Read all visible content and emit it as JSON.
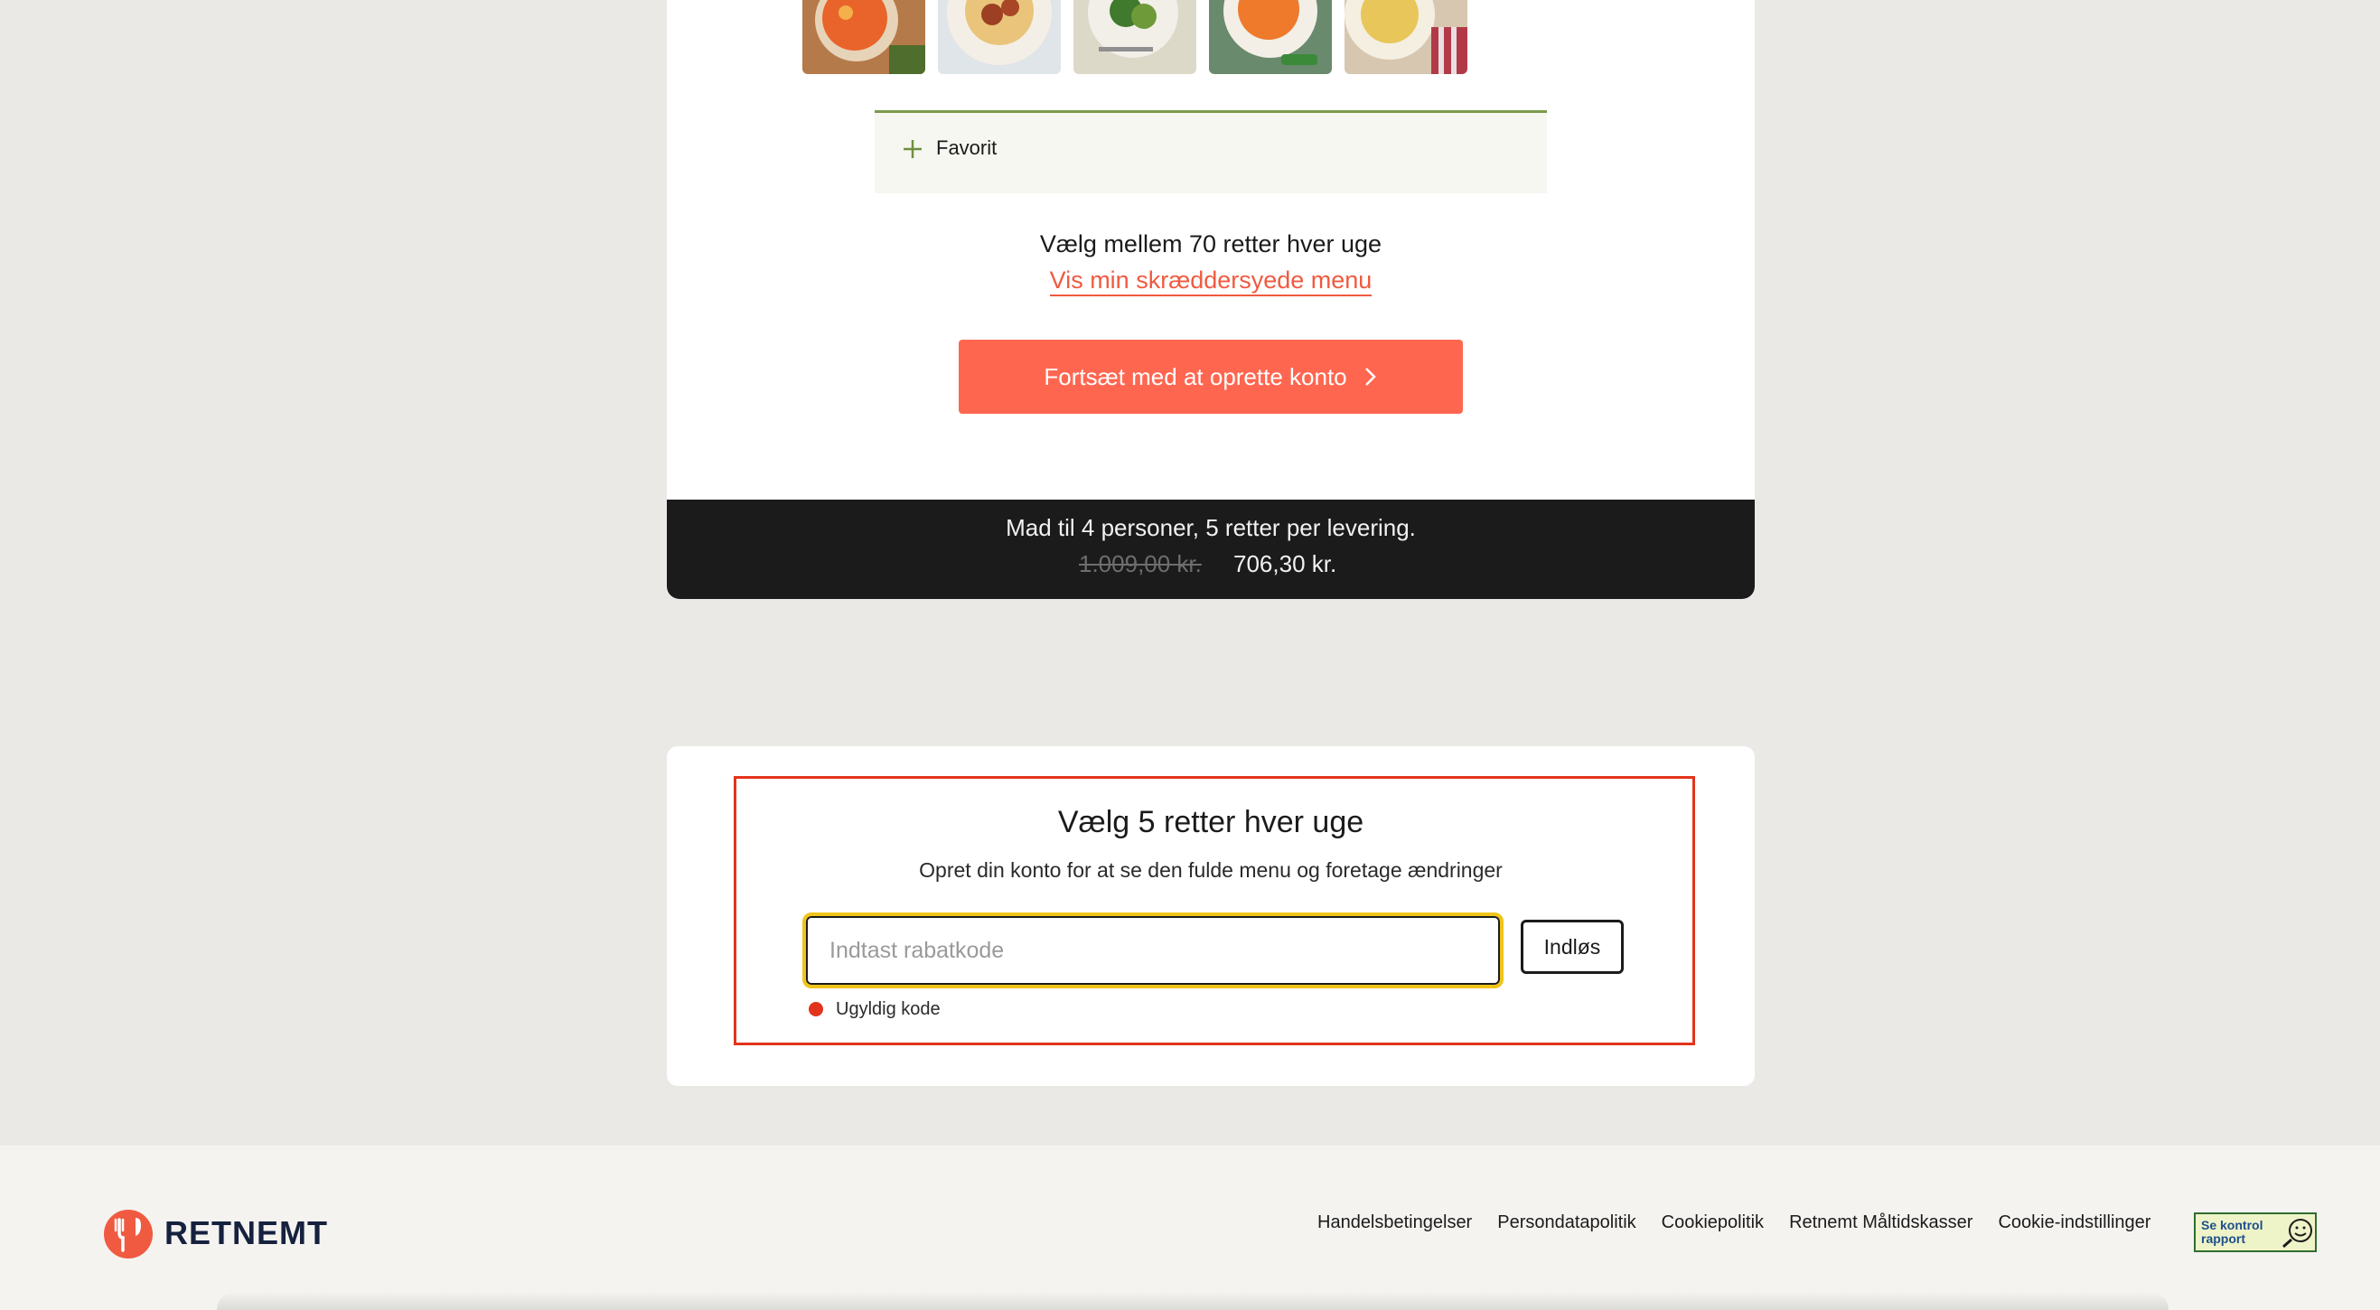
{
  "meal_card": {
    "thumbnails": [
      {
        "icon": "dish-photo-pasta-bake"
      },
      {
        "icon": "dish-photo-meatballs"
      },
      {
        "icon": "dish-photo-broccoli-plate"
      },
      {
        "icon": "dish-photo-carrot-dish"
      },
      {
        "icon": "dish-photo-pasta-chicken"
      }
    ],
    "favorite_label": "Favorit",
    "choose_text": "Vælg mellem 70 retter hver uge",
    "menu_link": "Vis min skræddersyede menu",
    "cta_label": "Fortsæt med at oprette konto",
    "summary": {
      "line": "Mad til 4 personer, 5 retter per levering.",
      "old_price": "1.009,00 kr.",
      "new_price": "706,30 kr."
    }
  },
  "code_card": {
    "title": "Vælg 5 retter hver uge",
    "subtitle": "Opret din konto for at se den fulde menu og foretage ændringer",
    "input_placeholder": "Indtast rabatkode",
    "input_value": "",
    "redeem_label": "Indløs",
    "error_text": "Ugyldig kode"
  },
  "footer": {
    "logo_text": "RETNEMT",
    "links": [
      "Handelsbetingelser",
      "Persondatapolitik",
      "Cookiepolitik",
      "Retnemt Måltidskasser",
      "Cookie-indstillinger"
    ],
    "badge_text": "Se kontrol rapport"
  },
  "colors": {
    "accent": "#ff6650",
    "error": "#e2341c",
    "focus_ring": "#f0c419",
    "favorite_green": "#7a9a4a"
  }
}
